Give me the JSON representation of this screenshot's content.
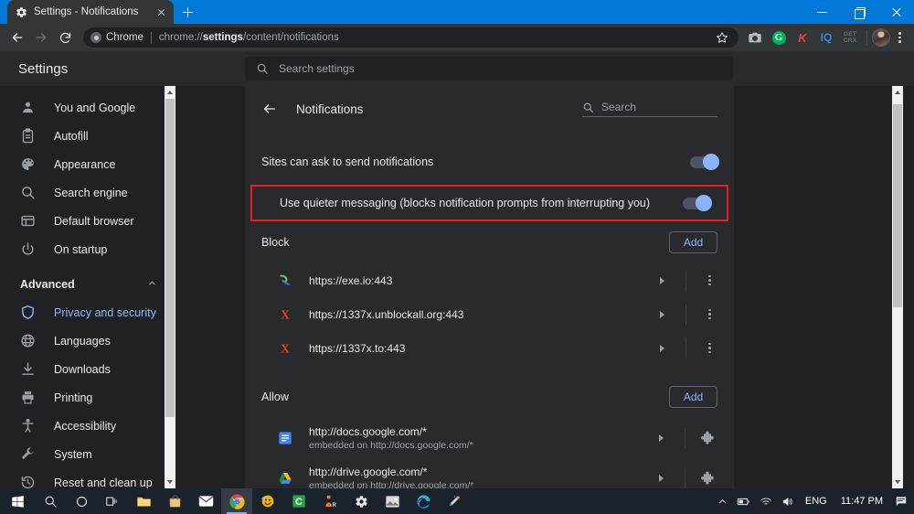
{
  "window": {
    "tab_title": "Settings - Notifications",
    "tab_favicon": "gear-icon",
    "new_tab_label": "+",
    "minimize_label": "",
    "maximize_label": "",
    "close_label": ""
  },
  "toolbar": {
    "back_label": "",
    "forward_label": "",
    "reload_label": "",
    "chrome_badge": "Chrome",
    "url_prefix": "chrome://",
    "url_bold": "settings",
    "url_suffix": "/content/notifications",
    "extensions": [
      {
        "name": "screenshot-extension-icon",
        "label": ""
      },
      {
        "name": "grammarly-extension-icon",
        "label": "G"
      },
      {
        "name": "kaspersky-extension-icon",
        "label": "K"
      },
      {
        "name": "iq-extension-icon",
        "label": "IQ"
      },
      {
        "name": "get-crx-extension-icon",
        "label1": "GET",
        "label2": "CRX"
      }
    ]
  },
  "settings_header": {
    "title": "Settings",
    "search_placeholder": "Search settings"
  },
  "sidebar": {
    "items": [
      {
        "label": "You and Google",
        "icon": "person-icon",
        "active": false
      },
      {
        "label": "Autofill",
        "icon": "clipboard-icon",
        "active": false
      },
      {
        "label": "Appearance",
        "icon": "palette-icon",
        "active": false
      },
      {
        "label": "Search engine",
        "icon": "search-icon",
        "active": false
      },
      {
        "label": "Default browser",
        "icon": "browser-window-icon",
        "active": false
      },
      {
        "label": "On startup",
        "icon": "power-icon",
        "active": false
      }
    ],
    "group_label": "Advanced",
    "group_expanded": true,
    "advanced_items": [
      {
        "label": "Privacy and security",
        "icon": "shield-icon",
        "active": true
      },
      {
        "label": "Languages",
        "icon": "globe-icon",
        "active": false
      },
      {
        "label": "Downloads",
        "icon": "download-icon",
        "active": false
      },
      {
        "label": "Printing",
        "icon": "printer-icon",
        "active": false
      },
      {
        "label": "Accessibility",
        "icon": "accessibility-icon",
        "active": false
      },
      {
        "label": "System",
        "icon": "wrench-icon",
        "active": false
      },
      {
        "label": "Reset and clean up",
        "icon": "history-icon",
        "active": false
      }
    ]
  },
  "main": {
    "page_title": "Notifications",
    "search_placeholder": "Search",
    "toggles": [
      {
        "label": "Sites can ask to send notifications",
        "on": true,
        "highlighted": false
      },
      {
        "label": "Use quieter messaging (blocks notification prompts from interrupting you)",
        "on": true,
        "highlighted": true
      }
    ],
    "highlight_color": "#ef1c1c",
    "accent_color": "#8ab4f8",
    "sections": [
      {
        "title": "Block",
        "add_label": "Add",
        "rows": [
          {
            "url": "https://exe.io:443",
            "sub": "",
            "favicon": "exe-io-favicon",
            "trailing": "kebab-menu-icon"
          },
          {
            "url": "https://1337x.unblockall.org:443",
            "sub": "",
            "favicon": "x-red-favicon",
            "trailing": "kebab-menu-icon"
          },
          {
            "url": "https://1337x.to:443",
            "sub": "",
            "favicon": "x-red-favicon",
            "trailing": "kebab-menu-icon"
          }
        ]
      },
      {
        "title": "Allow",
        "add_label": "Add",
        "rows": [
          {
            "url": "http://docs.google.com/*",
            "sub": "embedded on http://docs.google.com/*",
            "favicon": "google-docs-favicon",
            "trailing": "puzzle-piece-icon"
          },
          {
            "url": "http://drive.google.com/*",
            "sub": "embedded on http://drive.google.com/*",
            "favicon": "google-drive-favicon",
            "trailing": "puzzle-piece-icon"
          }
        ]
      }
    ]
  },
  "taskbar": {
    "items": [
      {
        "name": "start-button",
        "icon": "windows-logo-icon"
      },
      {
        "name": "search-button",
        "icon": "magnifier-icon"
      },
      {
        "name": "cortana-button",
        "icon": "circle-icon"
      },
      {
        "name": "task-view-button",
        "icon": "task-view-icon"
      },
      {
        "name": "file-explorer-button",
        "icon": "folder-icon"
      },
      {
        "name": "microsoft-store-button",
        "icon": "store-bag-icon"
      },
      {
        "name": "mail-button",
        "icon": "envelope-icon"
      },
      {
        "name": "chrome-button",
        "icon": "chrome-icon",
        "running": true
      },
      {
        "name": "emoji-app-button",
        "icon": "emoji-icon"
      },
      {
        "name": "camtasia-button",
        "icon": "green-c-icon"
      },
      {
        "name": "jr-app-button",
        "icon": "orange-person-icon"
      },
      {
        "name": "settings-app-button",
        "icon": "gear-icon"
      },
      {
        "name": "photos-button",
        "icon": "photos-icon"
      },
      {
        "name": "edge-button",
        "icon": "edge-icon"
      },
      {
        "name": "paint3d-button",
        "icon": "paint-icon"
      }
    ],
    "tray": {
      "chevron": "chevron-up-icon",
      "battery": "battery-icon",
      "network": "wifi-icon",
      "volume": "speaker-icon",
      "language": "ENG",
      "time": "11:47 PM",
      "action_center": "notification-icon"
    }
  }
}
